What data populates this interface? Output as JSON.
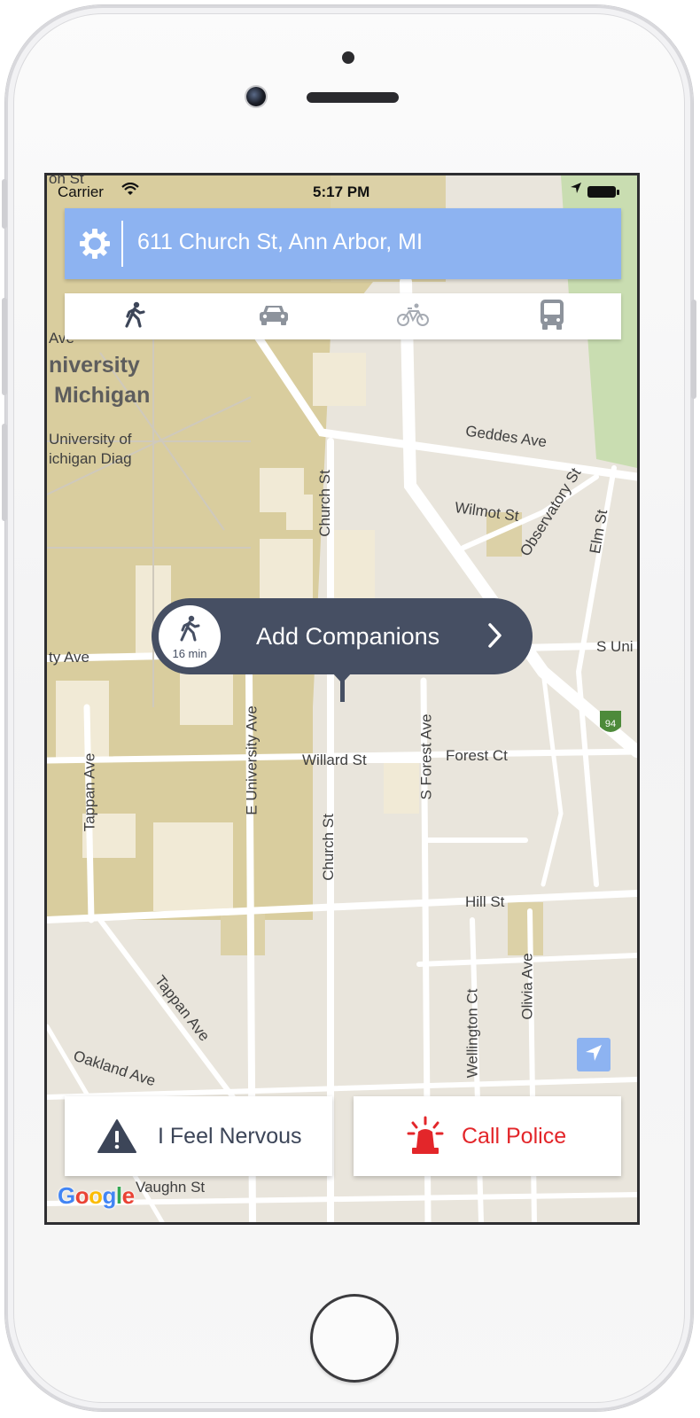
{
  "status_bar": {
    "carrier": "Carrier",
    "time": "5:17 PM"
  },
  "search": {
    "address": "611 Church St, Ann Arbor, MI",
    "settings_icon": "gear-icon"
  },
  "travel_modes": [
    {
      "name": "walk",
      "icon": "walking-icon",
      "active": true
    },
    {
      "name": "car",
      "icon": "car-icon",
      "active": false
    },
    {
      "name": "bike",
      "icon": "bicycle-icon",
      "active": false
    },
    {
      "name": "bus",
      "icon": "bus-icon",
      "active": false
    }
  ],
  "companion_bubble": {
    "label": "Add Companions",
    "eta": "16 min",
    "icon": "walking-icon"
  },
  "actions": {
    "nervous_label": "I Feel Nervous",
    "police_label": "Call Police"
  },
  "map": {
    "labels": {
      "university_line1": "niversity",
      "university_line2": "Michigan",
      "diag_line1": "University of",
      "diag_line2": "ichigan Diag",
      "geddes": "Geddes Ave",
      "wilmot": "Wilmot St",
      "observatory": "Observatory St",
      "elm": "Elm St",
      "church_top": "Church St",
      "church_bottom": "Church St",
      "s_uni": "S Uni",
      "ty_ave": "ty Ave",
      "willard": "Willard St",
      "forest_ct": "Forest Ct",
      "s_forest": "S Forest Ave",
      "e_university": "E University Ave",
      "tappan_left": "Tappan Ave",
      "tappan_diag": "Tappan Ave",
      "hill": "Hill St",
      "wellington": "Wellington Ct",
      "olivia": "Olivia Ave",
      "oakland": "Oakland Ave",
      "vaughn": "Vaughn St",
      "highway": "94",
      "ave_top": "Ave",
      "on_st": "on St"
    },
    "brand": [
      "G",
      "o",
      "o",
      "g",
      "l",
      "e"
    ]
  },
  "colors": {
    "accent_blue": "#8db3f1",
    "bubble": "#464f63",
    "police_red": "#e3262a",
    "icon_dark": "#3c4558"
  }
}
